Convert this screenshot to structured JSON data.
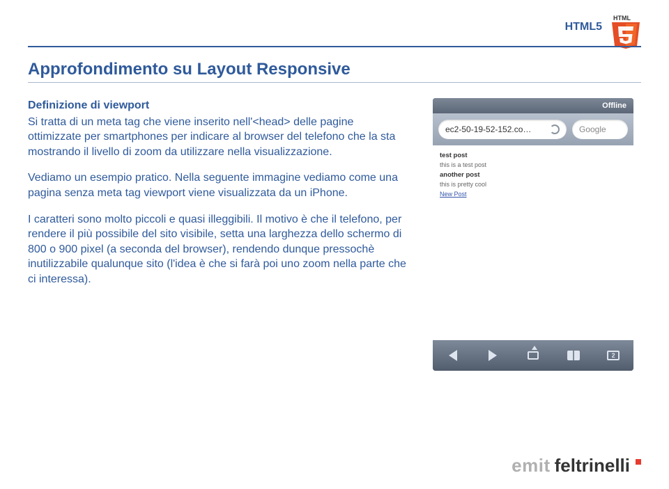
{
  "header": {
    "topright_label": "HTML5",
    "logo_top_text": "HTML"
  },
  "section": {
    "title": "Approfondimento su Layout Responsive"
  },
  "content": {
    "subheading": "Definizione di viewport",
    "p1": "Si tratta di un meta tag che viene inserito nell'<head> delle pagine ottimizzate per smartphones per indicare al browser del telefono che la sta mostrando il livello di zoom da utilizzare nella visualizzazione.",
    "p2": "Vediamo un esempio pratico. Nella seguente immagine vediamo come una pagina senza meta tag viewport viene visualizzata da un iPhone.",
    "p3": "I caratteri sono molto piccoli e quasi illeggibili. Il motivo è che il telefono, per rendere il più possibile del sito visibile, setta una larghezza dello schermo di 800 o 900 pixel (a seconda del browser), rendendo dunque pressochè inutilizzabile qualunque sito (l'idea è che si farà poi uno zoom nella parte che ci interessa)."
  },
  "phone": {
    "status": "Offline",
    "url": "ec2-50-19-52-152.co…",
    "search_placeholder": "Google",
    "page": {
      "line1_title": "test post",
      "line1_body": "this is a test post",
      "line2_title": "another post",
      "line2_body": "this is pretty cool",
      "new_post": "New Post"
    },
    "pages_count": "2"
  },
  "footer": {
    "brand_left": "emit",
    "brand_right": "feltrinelli"
  }
}
